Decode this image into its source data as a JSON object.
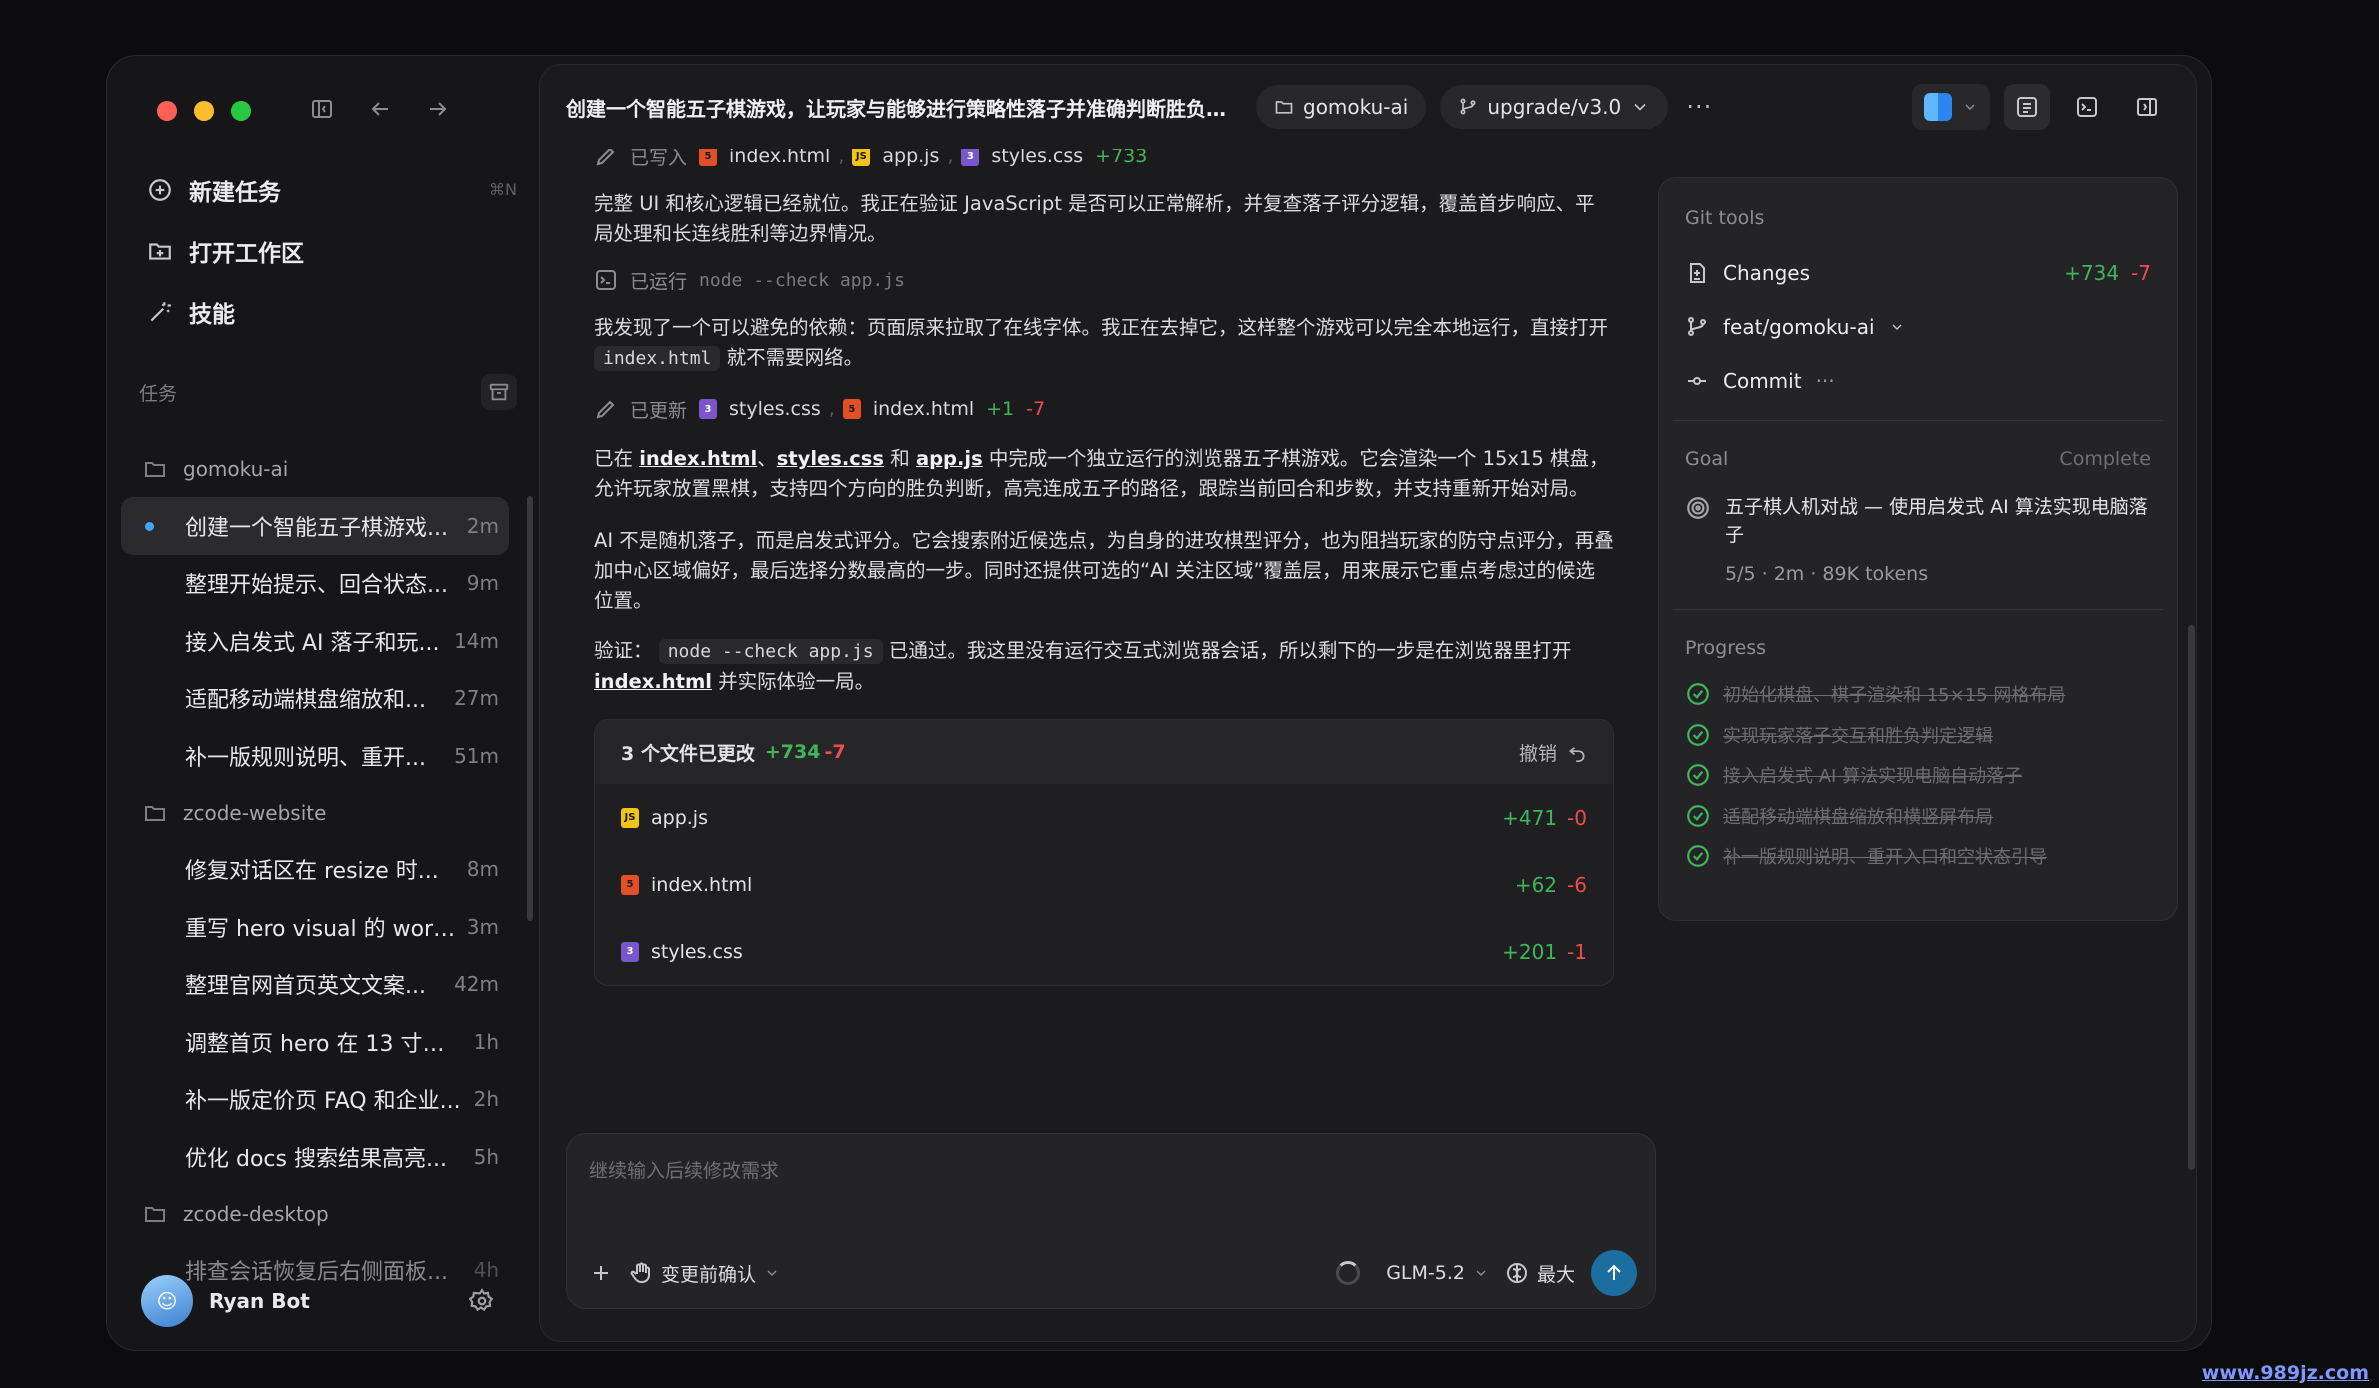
{
  "sidebar": {
    "menu": [
      {
        "label": "新建任务",
        "shortcut": "⌘N",
        "icon": "new-task-icon"
      },
      {
        "label": "打开工作区",
        "shortcut": "",
        "icon": "open-folder-icon"
      },
      {
        "label": "技能",
        "shortcut": "",
        "icon": "magic-wand-icon"
      }
    ],
    "tasks_header": "任务",
    "projects": [
      {
        "name": "gomoku-ai",
        "tasks": [
          {
            "name": "创建一个智能五子棋游戏...",
            "age": "2m",
            "active": true
          },
          {
            "name": "整理开始提示、回合状态...",
            "age": "9m"
          },
          {
            "name": "接入启发式 AI 落子和玩...",
            "age": "14m"
          },
          {
            "name": "适配移动端棋盘缩放和...",
            "age": "27m"
          },
          {
            "name": "补一版规则说明、重开...",
            "age": "51m"
          }
        ]
      },
      {
        "name": "zcode-website",
        "tasks": [
          {
            "name": "修复对话区在 resize 时...",
            "age": "8m"
          },
          {
            "name": "重写 hero visual 的 work...",
            "age": "3m"
          },
          {
            "name": "整理官网首页英文文案...",
            "age": "42m"
          },
          {
            "name": "调整首页 hero 在 13 寸和...",
            "age": "1h"
          },
          {
            "name": "补一版定价页 FAQ 和企业...",
            "age": "2h"
          },
          {
            "name": "优化 docs 搜索结果高亮...",
            "age": "5h"
          }
        ]
      },
      {
        "name": "zcode-desktop",
        "tasks": [
          {
            "name": "排查会话恢复后右侧面板...",
            "age": "4h"
          }
        ]
      }
    ],
    "user": {
      "name": "Ryan Bot"
    }
  },
  "topbar": {
    "title": "创建一个智能五子棋游戏，让玩家与能够进行策略性落子并准确判断胜负的...",
    "project_chip": "gomoku-ai",
    "branch_chip": "upgrade/v3.0"
  },
  "conversation": {
    "written": {
      "label": "已写入",
      "files": [
        "index.html",
        "app.js",
        "styles.css"
      ],
      "added": "+733"
    },
    "p1": "完整 UI 和核心逻辑已经就位。我正在验证 JavaScript 是否可以正常解析，并复查落子评分逻辑，覆盖首步响应、平局处理和长连线胜利等边界情况。",
    "ran": {
      "label": "已运行",
      "cmd": "node --check app.js"
    },
    "p2a": "我发现了一个可以避免的依赖：页面原来拉取了在线字体。我正在去掉它，这样整个游戏可以完全本地运行，直接打开",
    "p2code": "index.html",
    "p2b": "就不需要网络。",
    "updated": {
      "label": "已更新",
      "files": [
        "styles.css",
        "index.html"
      ],
      "added": "+1",
      "removed": "-7"
    },
    "p3a": "已在",
    "p3f1": "index.html",
    "p3s1": "、",
    "p3f2": "styles.css",
    "p3s2": " 和 ",
    "p3f3": "app.js",
    "p3b": " 中完成一个独立运行的浏览器五子棋游戏。它会渲染一个 15x15 棋盘，允许玩家放置黑棋，支持四个方向的胜负判断，高亮连成五子的路径，跟踪当前回合和步数，并支持重新开始对局。",
    "p4": "AI 不是随机落子，而是启发式评分。它会搜索附近候选点，为自身的进攻棋型评分，也为阻挡玩家的防守点评分，再叠加中心区域偏好，最后选择分数最高的一步。同时还提供可选的“AI 关注区域”覆盖层，用来展示它重点考虑过的候选位置。",
    "p5a": "验证：",
    "p5code": "node --check app.js",
    "p5b": " 已通过。我这里没有运行交互式浏览器会话，所以剩下的一步是在浏览器里打开",
    "p5link": "index.html",
    "p5c": " 并实际体验一局。",
    "changes": {
      "title": "3 个文件已更改",
      "added": "+734",
      "removed": "-7",
      "undo": "撤销",
      "files": [
        {
          "name": "app.js",
          "type": "js",
          "added": "+471",
          "removed": "-0"
        },
        {
          "name": "index.html",
          "type": "html",
          "added": "+62",
          "removed": "-6"
        },
        {
          "name": "styles.css",
          "type": "css",
          "added": "+201",
          "removed": "-1"
        }
      ]
    }
  },
  "composer": {
    "placeholder": "继续输入后续修改需求",
    "approval": "变更前确认",
    "model": "GLM-5.2",
    "effort": "最大"
  },
  "git_tools": {
    "header": "Git tools",
    "changes_label": "Changes",
    "changes_added": "+734",
    "changes_removed": "-7",
    "branch": "feat/gomoku-ai",
    "commit": "Commit",
    "goal_header": "Goal",
    "goal_status": "Complete",
    "goal_text": "五子棋人机对战 — 使用启发式 AI 算法实现电脑落子",
    "goal_meta": "5/5 · 2m · 89K tokens",
    "progress_header": "Progress",
    "progress": [
      "初始化棋盘、棋子渲染和 15×15 网格布局",
      "实现玩家落子交互和胜负判定逻辑",
      "接入启发式 AI 算法实现电脑自动落子",
      "适配移动端棋盘缩放和横竖屏布局",
      "补一版规则说明、重开入口和空状态引导"
    ]
  },
  "watermark": "www.989jz.com",
  "colors": {
    "added": "#3fb65a",
    "removed": "#ef4c4c",
    "accent": "#3ea6ff",
    "send": "#1b6e9f"
  }
}
